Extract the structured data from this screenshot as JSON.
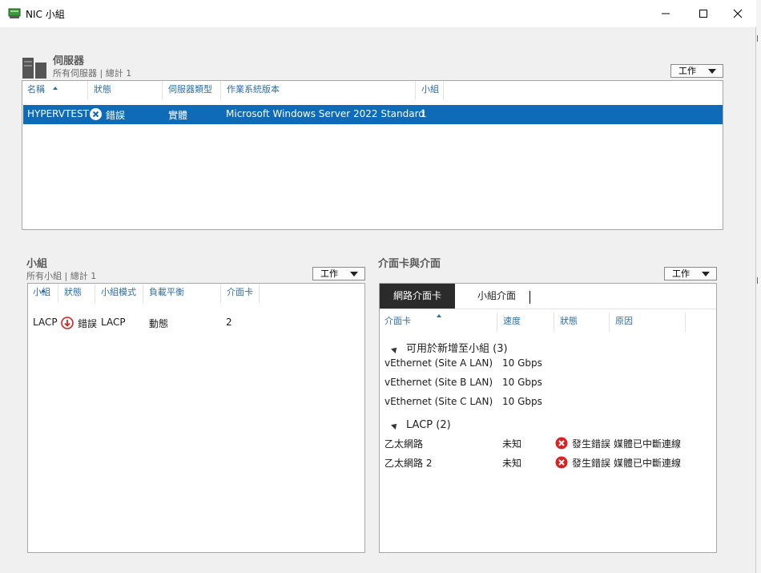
{
  "window": {
    "title": "NIC 小組"
  },
  "servers": {
    "title": "伺服器",
    "subtitle": "所有伺服器 | 總計 1",
    "task_label": "工作",
    "columns": [
      "名稱",
      "狀態",
      "伺服器類型",
      "作業系統版本",
      "小組"
    ],
    "rows": [
      {
        "name": "HYPERVTEST",
        "status": "錯誤",
        "type": "實體",
        "os": "Microsoft Windows Server 2022 Standard",
        "team": "1"
      }
    ]
  },
  "teams": {
    "title": "小組",
    "subtitle": "所有小組 | 總計 1",
    "task_label": "工作",
    "columns": [
      "小組",
      "狀態",
      "小組模式",
      "負載平衡",
      "介面卡"
    ],
    "rows": [
      {
        "team": "LACP",
        "status": "錯誤",
        "mode": "LACP",
        "lb": "動態",
        "adapters": "2"
      }
    ]
  },
  "adapters": {
    "title": "介面卡與介面",
    "task_label": "工作",
    "tabs": [
      "網路介面卡",
      "小組介面"
    ],
    "columns": [
      "介面卡",
      "速度",
      "狀態",
      "原因"
    ],
    "groups": [
      {
        "label": "可用於新增至小組 (3)",
        "items": [
          {
            "name": "vEthernet (Site A LAN)",
            "speed": "10 Gbps",
            "status": "",
            "reason": ""
          },
          {
            "name": "vEthernet (Site B LAN)",
            "speed": "10 Gbps",
            "status": "",
            "reason": ""
          },
          {
            "name": "vEthernet (Site C LAN)",
            "speed": "10 Gbps",
            "status": "",
            "reason": ""
          }
        ]
      },
      {
        "label": "LACP (2)",
        "items": [
          {
            "name": "乙太網路",
            "speed": "未知",
            "status": "發生錯誤",
            "reason": "媒體已中斷連線"
          },
          {
            "name": "乙太網路 2",
            "speed": "未知",
            "status": "發生錯誤",
            "reason": "媒體已中斷連線"
          }
        ]
      }
    ]
  },
  "colors": {
    "selection": "#0f6ab7",
    "header_text": "#2f6ea4",
    "error_red": "#d42424"
  },
  "icons": {
    "app": "network-adapter-icon",
    "server_section": "server-rack-icon",
    "error": "error-circle-icon",
    "team_error": "team-down-arrow-icon"
  }
}
